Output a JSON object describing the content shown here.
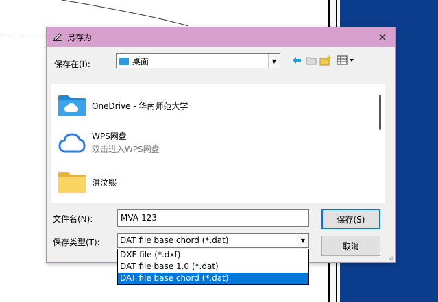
{
  "dialog": {
    "title": "另存为",
    "save_in_label": "保存在(I):",
    "save_in_value": "桌面",
    "filename_label": "文件名(N):",
    "filename_value": "MVA-123",
    "filetype_label": "保存类型(T):",
    "filetype_value": "DAT file base chord (*.dat)",
    "save_button": "保存(S)",
    "cancel_button": "取消"
  },
  "files": [
    {
      "name": "OneDrive - 华南师范大学",
      "icon": "onedrive-folder-icon"
    },
    {
      "name": "WPS网盘",
      "sub": "双击进入WPS网盘",
      "icon": "wps-cloud-icon"
    },
    {
      "name": "洪汶熙",
      "icon": "folder-icon"
    }
  ],
  "filetype_options": [
    "DXF file (*.dxf)",
    "DAT file base 1.0 (*.dat)",
    "DAT file base chord (*.dat)"
  ],
  "colors": {
    "titlebar": "#d8a0cf",
    "selection": "#0078d7",
    "background_blue": "#0b3d8c"
  }
}
